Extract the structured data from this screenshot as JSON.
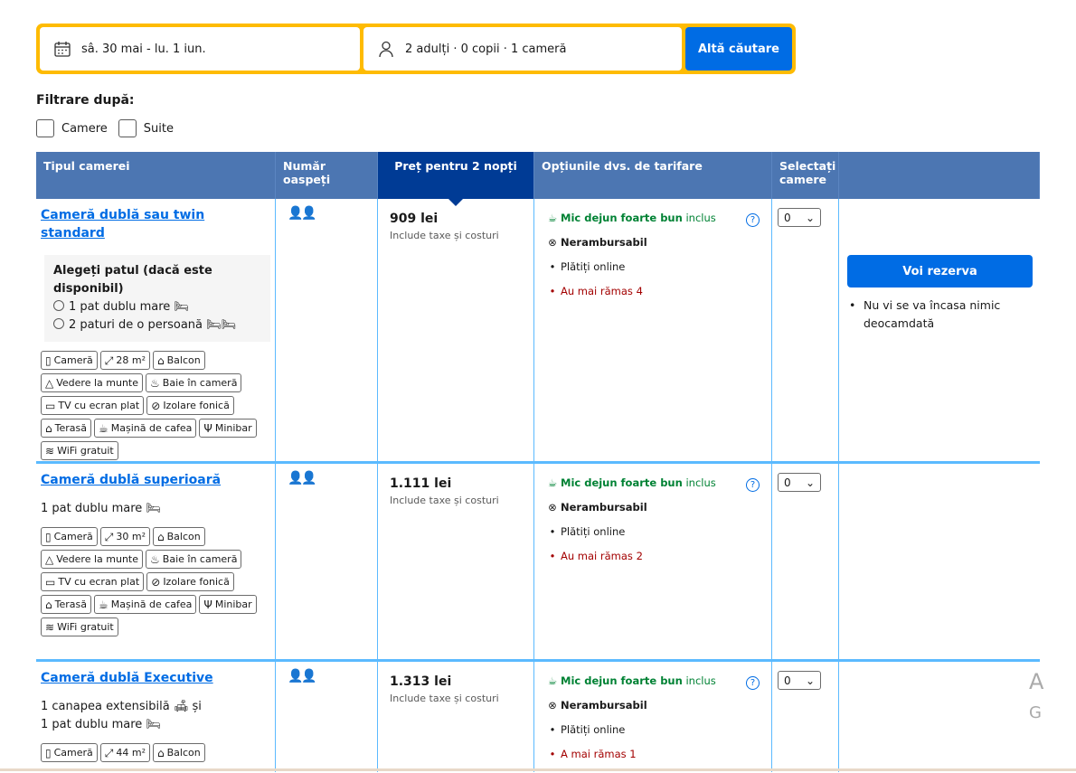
{
  "search": {
    "dates": "sâ. 30 mai - lu. 1 iun.",
    "guests": "2 adulți · 0 copii · 1 cameră",
    "button": "Altă căutare"
  },
  "filters": {
    "title": "Filtrare după:",
    "options": [
      "Camere",
      "Suite"
    ]
  },
  "table": {
    "headers": [
      "Tipul camerei",
      "Număr oaspeți",
      "Preț pentru 2 nopți",
      "Opțiunile dvs. de tarifare",
      "Selectați camere",
      ""
    ],
    "rooms": [
      {
        "name": "Cameră dublă sau twin standard",
        "bed_title": "Alegeți patul (dacă este disponibil)",
        "bed_options": [
          "1 pat dublu mare",
          "2 paturi de o persoană"
        ],
        "facilities": [
          "Cameră",
          "28 m²",
          "Balcon",
          "Vedere la munte",
          "Baie în cameră",
          "TV cu ecran plat",
          "Izolare fonică",
          "Terasă",
          "Mașină de cafea",
          "Minibar",
          "WiFi gratuit"
        ],
        "price": "909 lei",
        "taxes": "Include taxe și costuri",
        "breakfast": "Mic dejun foarte bun",
        "breakfast_incl": "inclus",
        "refund": "Nerambursabil",
        "pay": "Plătiți online",
        "left": "Au mai rămas 4",
        "select": "0"
      },
      {
        "name": "Cameră dublă superioară",
        "bed_text": "1 pat dublu mare",
        "facilities": [
          "Cameră",
          "30 m²",
          "Balcon",
          "Vedere la munte",
          "Baie în cameră",
          "TV cu ecran plat",
          "Izolare fonică",
          "Terasă",
          "Mașină de cafea",
          "Minibar",
          "WiFi gratuit"
        ],
        "price": "1.111 lei",
        "taxes": "Include taxe și costuri",
        "breakfast": "Mic dejun foarte bun",
        "breakfast_incl": "inclus",
        "refund": "Nerambursabil",
        "pay": "Plătiți online",
        "left": "Au mai rămas 2",
        "select": "0"
      },
      {
        "name": "Cameră dublă Executive",
        "bed_text_1": "1 canapea extensibilă",
        "bed_text_1b": "și",
        "bed_text_2": "1 pat dublu mare",
        "facilities": [
          "Cameră",
          "44 m²",
          "Balcon"
        ],
        "price": "1.313 lei",
        "taxes": "Include taxe și costuri",
        "breakfast": "Mic dejun foarte bun",
        "breakfast_incl": "inclus",
        "refund": "Nerambursabil",
        "pay": "Plătiți online",
        "left": "A mai rămas 1",
        "select": "0"
      }
    ]
  },
  "reserve": {
    "button": "Voi rezerva",
    "note": "Nu vi se va încasa nimic deocamdată"
  },
  "side": {
    "a": "A",
    "g": "G"
  },
  "colors": {
    "accent": "#006ce4",
    "header": "#4c76b2",
    "price_header": "#003b95",
    "search_border": "#febb02",
    "green": "#008234",
    "red": "#a30000"
  }
}
